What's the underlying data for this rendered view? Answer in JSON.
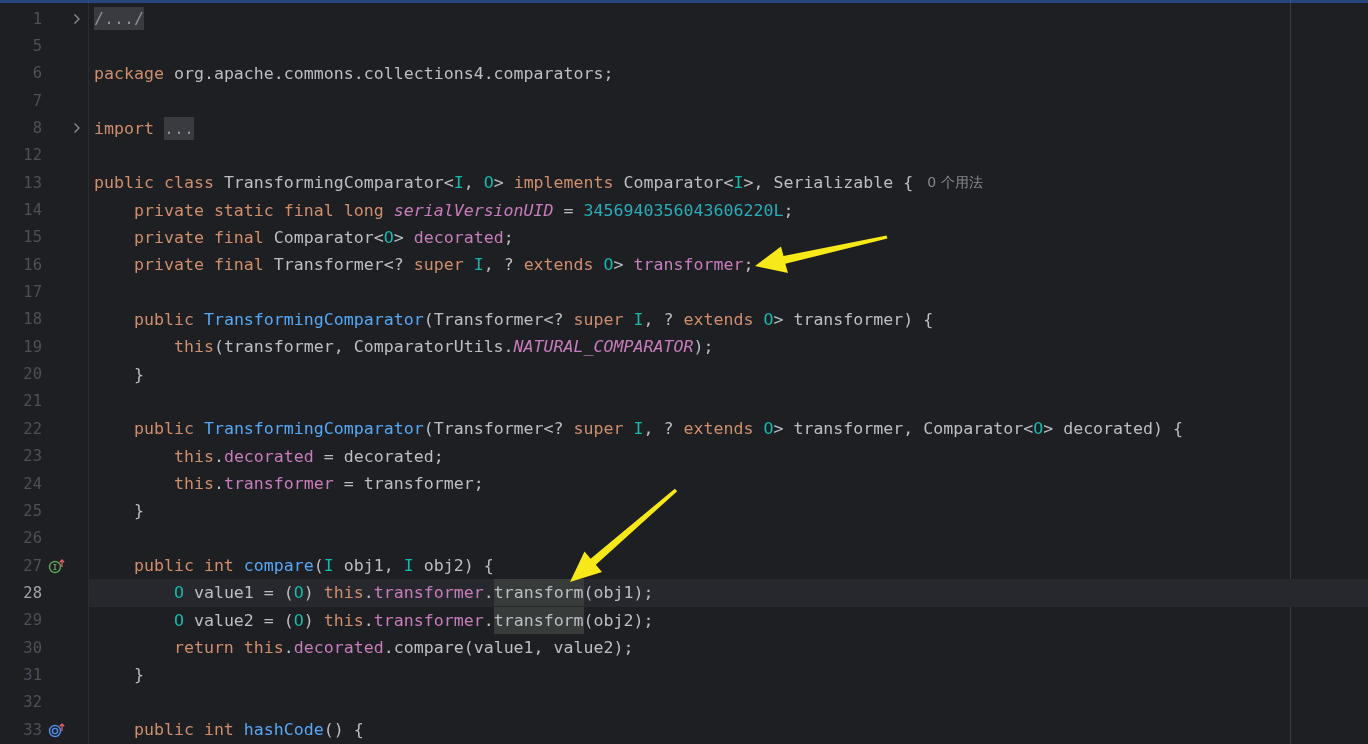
{
  "editor": {
    "lines": [
      {
        "num": "1",
        "folded": true,
        "current": false,
        "tokens": [
          {
            "text": "/.../",
            "kind": "fold"
          }
        ]
      },
      {
        "num": "5",
        "folded": false,
        "current": false
      },
      {
        "num": "6",
        "folded": false,
        "current": false,
        "tokens": [
          {
            "text": "package",
            "kind": "keyword"
          },
          {
            "text": " org.apache.commons.collections4.comparators;",
            "kind": "plain"
          }
        ]
      },
      {
        "num": "7",
        "folded": false,
        "current": false
      },
      {
        "num": "8",
        "folded": true,
        "current": false,
        "tokens": [
          {
            "text": "import ",
            "kind": "keyword"
          },
          {
            "text": "...",
            "kind": "fold"
          }
        ]
      },
      {
        "num": "12",
        "folded": false,
        "current": false
      },
      {
        "num": "13",
        "folded": false,
        "current": false,
        "tokens": [
          {
            "text": "public class",
            "kind": "keyword"
          },
          {
            "text": " TransformingComparator<",
            "kind": "plain"
          },
          {
            "text": "I",
            "kind": "typeparam"
          },
          {
            "text": ", ",
            "kind": "plain"
          },
          {
            "text": "O",
            "kind": "typeparam"
          },
          {
            "text": "> ",
            "kind": "plain"
          },
          {
            "text": "implements",
            "kind": "keyword"
          },
          {
            "text": " Comparator<",
            "kind": "plain"
          },
          {
            "text": "I",
            "kind": "typeparam"
          },
          {
            "text": ">, Serializable {",
            "kind": "plain"
          },
          {
            "text": "0 个用法",
            "kind": "hint"
          }
        ]
      },
      {
        "num": "14",
        "folded": false,
        "current": false,
        "tokens": [
          {
            "text": "    private static final long ",
            "kind": "keyword"
          },
          {
            "text": "serialVersionUID",
            "kind": "static"
          },
          {
            "text": " = ",
            "kind": "plain"
          },
          {
            "text": "3456940356043606220L",
            "kind": "number"
          },
          {
            "text": ";",
            "kind": "plain"
          }
        ]
      },
      {
        "num": "15",
        "folded": false,
        "current": false,
        "tokens": [
          {
            "text": "    private final",
            "kind": "keyword"
          },
          {
            "text": " Comparator<",
            "kind": "plain"
          },
          {
            "text": "O",
            "kind": "typeparam"
          },
          {
            "text": "> ",
            "kind": "plain"
          },
          {
            "text": "decorated",
            "kind": "field"
          },
          {
            "text": ";",
            "kind": "plain"
          }
        ]
      },
      {
        "num": "16",
        "folded": false,
        "current": false,
        "tokens": [
          {
            "text": "    private final",
            "kind": "keyword"
          },
          {
            "text": " Transformer<? ",
            "kind": "plain"
          },
          {
            "text": "super ",
            "kind": "keyword"
          },
          {
            "text": "I",
            "kind": "typeparam"
          },
          {
            "text": ", ? ",
            "kind": "plain"
          },
          {
            "text": "extends ",
            "kind": "keyword"
          },
          {
            "text": "O",
            "kind": "typeparam"
          },
          {
            "text": "> ",
            "kind": "plain"
          },
          {
            "text": "transformer",
            "kind": "field"
          },
          {
            "text": ";",
            "kind": "plain"
          }
        ]
      },
      {
        "num": "17",
        "folded": false,
        "current": false
      },
      {
        "num": "18",
        "folded": false,
        "current": false,
        "tokens": [
          {
            "text": "    public ",
            "kind": "keyword"
          },
          {
            "text": "TransformingComparator",
            "kind": "method"
          },
          {
            "text": "(Transformer<? ",
            "kind": "plain"
          },
          {
            "text": "super ",
            "kind": "keyword"
          },
          {
            "text": "I",
            "kind": "typeparam"
          },
          {
            "text": ", ? ",
            "kind": "plain"
          },
          {
            "text": "extends ",
            "kind": "keyword"
          },
          {
            "text": "O",
            "kind": "typeparam"
          },
          {
            "text": "> transformer) {",
            "kind": "plain"
          }
        ]
      },
      {
        "num": "19",
        "folded": false,
        "current": false,
        "tokens": [
          {
            "text": "        this",
            "kind": "keyword"
          },
          {
            "text": "(transformer, ComparatorUtils.",
            "kind": "plain"
          },
          {
            "text": "NATURAL_COMPARATOR",
            "kind": "static"
          },
          {
            "text": ");",
            "kind": "plain"
          }
        ]
      },
      {
        "num": "20",
        "folded": false,
        "current": false,
        "tokens": [
          {
            "text": "    }",
            "kind": "plain"
          }
        ]
      },
      {
        "num": "21",
        "folded": false,
        "current": false
      },
      {
        "num": "22",
        "folded": false,
        "current": false,
        "tokens": [
          {
            "text": "    public ",
            "kind": "keyword"
          },
          {
            "text": "TransformingComparator",
            "kind": "method"
          },
          {
            "text": "(Transformer<? ",
            "kind": "plain"
          },
          {
            "text": "super ",
            "kind": "keyword"
          },
          {
            "text": "I",
            "kind": "typeparam"
          },
          {
            "text": ", ? ",
            "kind": "plain"
          },
          {
            "text": "extends ",
            "kind": "keyword"
          },
          {
            "text": "O",
            "kind": "typeparam"
          },
          {
            "text": "> transformer, Comparator<",
            "kind": "plain"
          },
          {
            "text": "O",
            "kind": "typeparam"
          },
          {
            "text": "> decorated) {",
            "kind": "plain"
          }
        ]
      },
      {
        "num": "23",
        "folded": false,
        "current": false,
        "tokens": [
          {
            "text": "        this",
            "kind": "keyword"
          },
          {
            "text": ".",
            "kind": "plain"
          },
          {
            "text": "decorated",
            "kind": "field"
          },
          {
            "text": " = decorated;",
            "kind": "plain"
          }
        ]
      },
      {
        "num": "24",
        "folded": false,
        "current": false,
        "tokens": [
          {
            "text": "        this",
            "kind": "keyword"
          },
          {
            "text": ".",
            "kind": "plain"
          },
          {
            "text": "transformer",
            "kind": "field"
          },
          {
            "text": " = transformer;",
            "kind": "plain"
          }
        ]
      },
      {
        "num": "25",
        "folded": false,
        "current": false,
        "tokens": [
          {
            "text": "    }",
            "kind": "plain"
          }
        ]
      },
      {
        "num": "26",
        "folded": false,
        "current": false
      },
      {
        "num": "27",
        "folded": false,
        "current": false,
        "gutter": {
          "kind": "implements"
        },
        "tokens": [
          {
            "text": "    public int ",
            "kind": "keyword"
          },
          {
            "text": "compare",
            "kind": "method"
          },
          {
            "text": "(",
            "kind": "plain"
          },
          {
            "text": "I",
            "kind": "typeparam"
          },
          {
            "text": " obj1, ",
            "kind": "plain"
          },
          {
            "text": "I",
            "kind": "typeparam"
          },
          {
            "text": " obj2) {",
            "kind": "plain"
          }
        ]
      },
      {
        "num": "28",
        "folded": false,
        "current": true,
        "tokens": [
          {
            "text": "        O",
            "kind": "typeparam"
          },
          {
            "text": " value1 = (",
            "kind": "plain"
          },
          {
            "text": "O",
            "kind": "typeparam"
          },
          {
            "text": ") ",
            "kind": "plain"
          },
          {
            "text": "this",
            "kind": "keyword"
          },
          {
            "text": ".",
            "kind": "plain"
          },
          {
            "text": "transformer",
            "kind": "field"
          },
          {
            "text": ".",
            "kind": "plain"
          },
          {
            "text": "transform",
            "kind": "usage"
          },
          {
            "text": "(obj1);",
            "kind": "plain"
          }
        ]
      },
      {
        "num": "29",
        "folded": false,
        "current": false,
        "tokens": [
          {
            "text": "        O",
            "kind": "typeparam"
          },
          {
            "text": " value2 = (",
            "kind": "plain"
          },
          {
            "text": "O",
            "kind": "typeparam"
          },
          {
            "text": ") ",
            "kind": "plain"
          },
          {
            "text": "this",
            "kind": "keyword"
          },
          {
            "text": ".",
            "kind": "plain"
          },
          {
            "text": "transformer",
            "kind": "field"
          },
          {
            "text": ".",
            "kind": "plain"
          },
          {
            "text": "transform",
            "kind": "usage"
          },
          {
            "text": "(obj2);",
            "kind": "plain"
          }
        ]
      },
      {
        "num": "30",
        "folded": false,
        "current": false,
        "tokens": [
          {
            "text": "        return this",
            "kind": "keyword"
          },
          {
            "text": ".",
            "kind": "plain"
          },
          {
            "text": "decorated",
            "kind": "field"
          },
          {
            "text": ".compare(value1, value2);",
            "kind": "plain"
          }
        ]
      },
      {
        "num": "31",
        "folded": false,
        "current": false,
        "tokens": [
          {
            "text": "    }",
            "kind": "plain"
          }
        ]
      },
      {
        "num": "32",
        "folded": false,
        "current": false
      },
      {
        "num": "33",
        "folded": false,
        "current": false,
        "gutter": {
          "kind": "overrides"
        },
        "tokens": [
          {
            "text": "    public int ",
            "kind": "keyword"
          },
          {
            "text": "hashCode",
            "kind": "method"
          },
          {
            "text": "() {",
            "kind": "plain"
          }
        ]
      }
    ]
  }
}
